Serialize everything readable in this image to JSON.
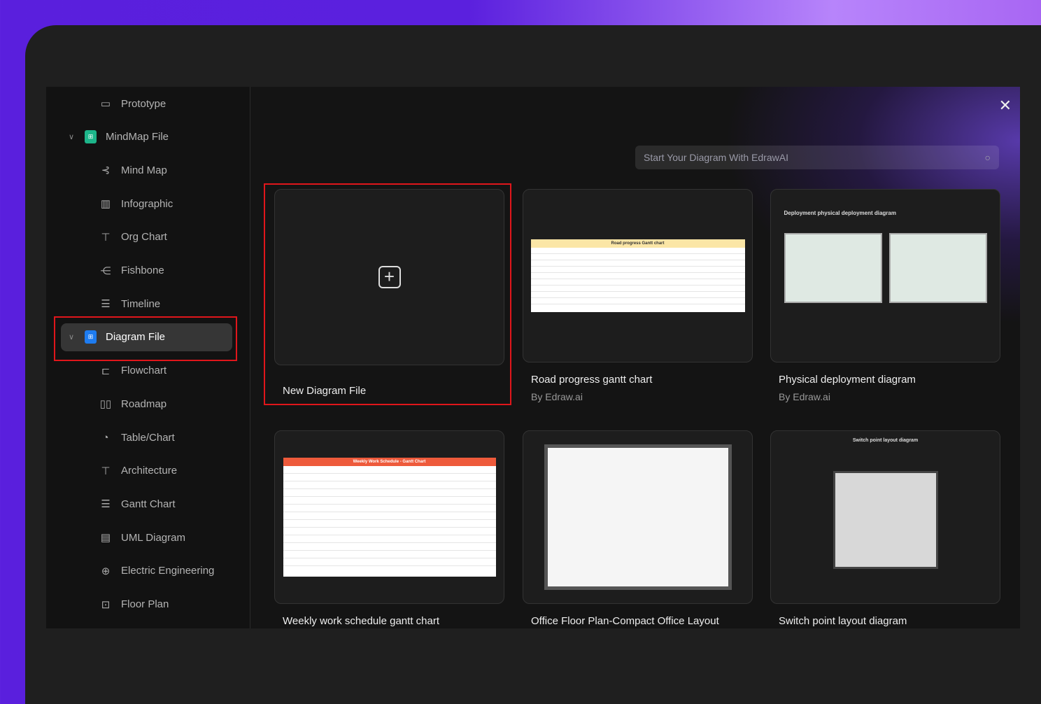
{
  "sidebar": {
    "items": [
      {
        "label": "Prototype",
        "icon": "prototype-icon"
      },
      {
        "label": "MindMap File",
        "icon": "mindmap-file-icon",
        "parent": true,
        "color": "#1db58a"
      },
      {
        "label": "Mind Map",
        "icon": "mind-map-icon"
      },
      {
        "label": "Infographic",
        "icon": "infographic-icon"
      },
      {
        "label": "Org Chart",
        "icon": "org-chart-icon"
      },
      {
        "label": "Fishbone",
        "icon": "fishbone-icon"
      },
      {
        "label": "Timeline",
        "icon": "timeline-icon"
      },
      {
        "label": "Diagram File",
        "icon": "diagram-file-icon",
        "parent": true,
        "active": true,
        "color": "#1e7cf0"
      },
      {
        "label": "Flowchart",
        "icon": "flowchart-icon"
      },
      {
        "label": "Roadmap",
        "icon": "roadmap-icon"
      },
      {
        "label": "Table/Chart",
        "icon": "table-chart-icon"
      },
      {
        "label": "Architecture",
        "icon": "architecture-icon"
      },
      {
        "label": "Gantt Chart",
        "icon": "gantt-chart-icon"
      },
      {
        "label": "UML Diagram",
        "icon": "uml-diagram-icon"
      },
      {
        "label": "Electric Engineering",
        "icon": "electric-engineering-icon"
      },
      {
        "label": "Floor Plan",
        "icon": "floor-plan-icon"
      }
    ]
  },
  "header": {
    "close_icon": "close-icon"
  },
  "search": {
    "placeholder": "Start Your Diagram With  EdrawAI",
    "icon": "search-icon"
  },
  "new_file": {
    "label": "New Diagram File",
    "icon": "plus-icon"
  },
  "templates": [
    {
      "title": "Road progress gantt chart",
      "author": "By Edraw.ai",
      "thumb_title": "Road progress Gantt chart"
    },
    {
      "title": "Physical deployment diagram",
      "author": "By Edraw.ai",
      "thumb_title": "Deployment physical deployment diagram"
    },
    {
      "title": "Weekly work schedule gantt chart",
      "author": "",
      "thumb_title": "Weekly Work Schedule - Gantt Chart"
    },
    {
      "title": "Office Floor Plan-Compact Office Layout",
      "author": "",
      "thumb_title": ""
    },
    {
      "title": "Switch point layout diagram",
      "author": "",
      "thumb_title": "Switch point layout diagram"
    }
  ],
  "colors": {
    "highlight": "#e0161b",
    "mindmap": "#1db58a",
    "diagram": "#1e7cf0"
  }
}
